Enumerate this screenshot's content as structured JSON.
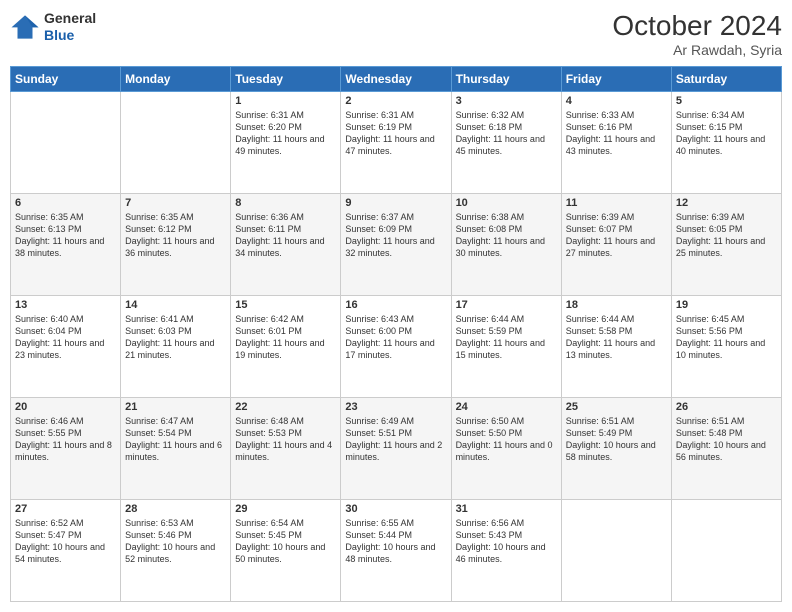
{
  "header": {
    "logo_general": "General",
    "logo_blue": "Blue",
    "title": "October 2024",
    "location": "Ar Rawdah, Syria"
  },
  "days_of_week": [
    "Sunday",
    "Monday",
    "Tuesday",
    "Wednesday",
    "Thursday",
    "Friday",
    "Saturday"
  ],
  "weeks": [
    [
      {
        "day": "",
        "sunrise": "",
        "sunset": "",
        "daylight": ""
      },
      {
        "day": "",
        "sunrise": "",
        "sunset": "",
        "daylight": ""
      },
      {
        "day": "1",
        "sunrise": "Sunrise: 6:31 AM",
        "sunset": "Sunset: 6:20 PM",
        "daylight": "Daylight: 11 hours and 49 minutes."
      },
      {
        "day": "2",
        "sunrise": "Sunrise: 6:31 AM",
        "sunset": "Sunset: 6:19 PM",
        "daylight": "Daylight: 11 hours and 47 minutes."
      },
      {
        "day": "3",
        "sunrise": "Sunrise: 6:32 AM",
        "sunset": "Sunset: 6:18 PM",
        "daylight": "Daylight: 11 hours and 45 minutes."
      },
      {
        "day": "4",
        "sunrise": "Sunrise: 6:33 AM",
        "sunset": "Sunset: 6:16 PM",
        "daylight": "Daylight: 11 hours and 43 minutes."
      },
      {
        "day": "5",
        "sunrise": "Sunrise: 6:34 AM",
        "sunset": "Sunset: 6:15 PM",
        "daylight": "Daylight: 11 hours and 40 minutes."
      }
    ],
    [
      {
        "day": "6",
        "sunrise": "Sunrise: 6:35 AM",
        "sunset": "Sunset: 6:13 PM",
        "daylight": "Daylight: 11 hours and 38 minutes."
      },
      {
        "day": "7",
        "sunrise": "Sunrise: 6:35 AM",
        "sunset": "Sunset: 6:12 PM",
        "daylight": "Daylight: 11 hours and 36 minutes."
      },
      {
        "day": "8",
        "sunrise": "Sunrise: 6:36 AM",
        "sunset": "Sunset: 6:11 PM",
        "daylight": "Daylight: 11 hours and 34 minutes."
      },
      {
        "day": "9",
        "sunrise": "Sunrise: 6:37 AM",
        "sunset": "Sunset: 6:09 PM",
        "daylight": "Daylight: 11 hours and 32 minutes."
      },
      {
        "day": "10",
        "sunrise": "Sunrise: 6:38 AM",
        "sunset": "Sunset: 6:08 PM",
        "daylight": "Daylight: 11 hours and 30 minutes."
      },
      {
        "day": "11",
        "sunrise": "Sunrise: 6:39 AM",
        "sunset": "Sunset: 6:07 PM",
        "daylight": "Daylight: 11 hours and 27 minutes."
      },
      {
        "day": "12",
        "sunrise": "Sunrise: 6:39 AM",
        "sunset": "Sunset: 6:05 PM",
        "daylight": "Daylight: 11 hours and 25 minutes."
      }
    ],
    [
      {
        "day": "13",
        "sunrise": "Sunrise: 6:40 AM",
        "sunset": "Sunset: 6:04 PM",
        "daylight": "Daylight: 11 hours and 23 minutes."
      },
      {
        "day": "14",
        "sunrise": "Sunrise: 6:41 AM",
        "sunset": "Sunset: 6:03 PM",
        "daylight": "Daylight: 11 hours and 21 minutes."
      },
      {
        "day": "15",
        "sunrise": "Sunrise: 6:42 AM",
        "sunset": "Sunset: 6:01 PM",
        "daylight": "Daylight: 11 hours and 19 minutes."
      },
      {
        "day": "16",
        "sunrise": "Sunrise: 6:43 AM",
        "sunset": "Sunset: 6:00 PM",
        "daylight": "Daylight: 11 hours and 17 minutes."
      },
      {
        "day": "17",
        "sunrise": "Sunrise: 6:44 AM",
        "sunset": "Sunset: 5:59 PM",
        "daylight": "Daylight: 11 hours and 15 minutes."
      },
      {
        "day": "18",
        "sunrise": "Sunrise: 6:44 AM",
        "sunset": "Sunset: 5:58 PM",
        "daylight": "Daylight: 11 hours and 13 minutes."
      },
      {
        "day": "19",
        "sunrise": "Sunrise: 6:45 AM",
        "sunset": "Sunset: 5:56 PM",
        "daylight": "Daylight: 11 hours and 10 minutes."
      }
    ],
    [
      {
        "day": "20",
        "sunrise": "Sunrise: 6:46 AM",
        "sunset": "Sunset: 5:55 PM",
        "daylight": "Daylight: 11 hours and 8 minutes."
      },
      {
        "day": "21",
        "sunrise": "Sunrise: 6:47 AM",
        "sunset": "Sunset: 5:54 PM",
        "daylight": "Daylight: 11 hours and 6 minutes."
      },
      {
        "day": "22",
        "sunrise": "Sunrise: 6:48 AM",
        "sunset": "Sunset: 5:53 PM",
        "daylight": "Daylight: 11 hours and 4 minutes."
      },
      {
        "day": "23",
        "sunrise": "Sunrise: 6:49 AM",
        "sunset": "Sunset: 5:51 PM",
        "daylight": "Daylight: 11 hours and 2 minutes."
      },
      {
        "day": "24",
        "sunrise": "Sunrise: 6:50 AM",
        "sunset": "Sunset: 5:50 PM",
        "daylight": "Daylight: 11 hours and 0 minutes."
      },
      {
        "day": "25",
        "sunrise": "Sunrise: 6:51 AM",
        "sunset": "Sunset: 5:49 PM",
        "daylight": "Daylight: 10 hours and 58 minutes."
      },
      {
        "day": "26",
        "sunrise": "Sunrise: 6:51 AM",
        "sunset": "Sunset: 5:48 PM",
        "daylight": "Daylight: 10 hours and 56 minutes."
      }
    ],
    [
      {
        "day": "27",
        "sunrise": "Sunrise: 6:52 AM",
        "sunset": "Sunset: 5:47 PM",
        "daylight": "Daylight: 10 hours and 54 minutes."
      },
      {
        "day": "28",
        "sunrise": "Sunrise: 6:53 AM",
        "sunset": "Sunset: 5:46 PM",
        "daylight": "Daylight: 10 hours and 52 minutes."
      },
      {
        "day": "29",
        "sunrise": "Sunrise: 6:54 AM",
        "sunset": "Sunset: 5:45 PM",
        "daylight": "Daylight: 10 hours and 50 minutes."
      },
      {
        "day": "30",
        "sunrise": "Sunrise: 6:55 AM",
        "sunset": "Sunset: 5:44 PM",
        "daylight": "Daylight: 10 hours and 48 minutes."
      },
      {
        "day": "31",
        "sunrise": "Sunrise: 6:56 AM",
        "sunset": "Sunset: 5:43 PM",
        "daylight": "Daylight: 10 hours and 46 minutes."
      },
      {
        "day": "",
        "sunrise": "",
        "sunset": "",
        "daylight": ""
      },
      {
        "day": "",
        "sunrise": "",
        "sunset": "",
        "daylight": ""
      }
    ]
  ]
}
